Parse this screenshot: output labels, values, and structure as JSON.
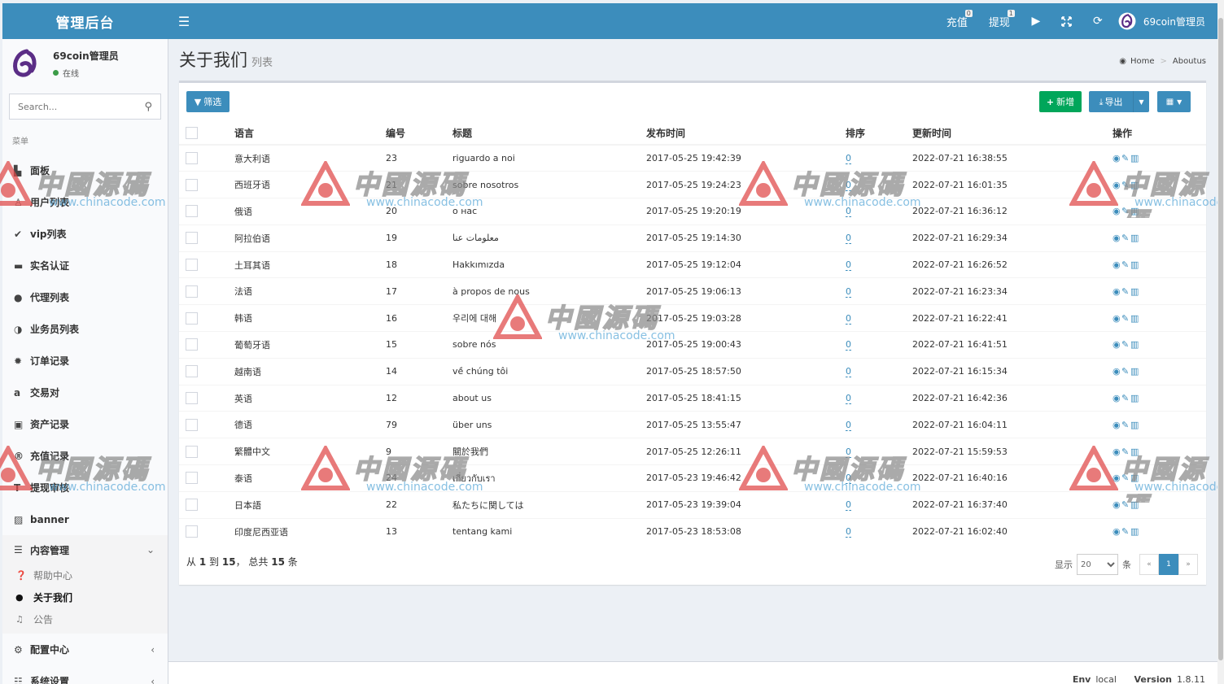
{
  "app": {
    "brand": "管理后台",
    "menu_toggle_icon": "hamburger-icon"
  },
  "topbar": {
    "recharge_label": "充值",
    "recharge_badge": "0",
    "withdraw_label": "提现",
    "withdraw_badge": "1",
    "user_name": "69coin管理员"
  },
  "sidebar": {
    "user_name": "69coin管理员",
    "user_status": "在线",
    "search_placeholder": "Search...",
    "menu_header": "菜单",
    "items": [
      {
        "label": "面板",
        "icon": "bar-chart-icon"
      },
      {
        "label": "用户列表",
        "icon": "users-icon"
      },
      {
        "label": "vip列表",
        "icon": "check-circle-icon"
      },
      {
        "label": "实名认证",
        "icon": "id-card-icon"
      },
      {
        "label": "代理列表",
        "icon": "circle-icon"
      },
      {
        "label": "业务员列表",
        "icon": "half-circle-icon"
      },
      {
        "label": "订单记录",
        "icon": "gear-icon"
      },
      {
        "label": "交易对",
        "icon": "amazon-icon"
      },
      {
        "label": "资产记录",
        "icon": "money-icon"
      },
      {
        "label": "充值记录",
        "icon": "registered-icon"
      },
      {
        "label": "提现审核",
        "icon": "text-height-icon"
      },
      {
        "label": "banner",
        "icon": "image-icon"
      }
    ],
    "content_menu": {
      "label": "内容管理",
      "children": [
        {
          "label": "帮助中心",
          "icon": "question-circle-icon"
        },
        {
          "label": "关于我们",
          "icon": "info-circle-icon"
        },
        {
          "label": "公告",
          "icon": "bell-icon"
        }
      ]
    },
    "config_menu": "配置中心",
    "settings_menu": "系统设置"
  },
  "page": {
    "title": "关于我们",
    "subtitle": "列表",
    "breadcrumb_home": "Home",
    "breadcrumb_current": "Aboutus"
  },
  "toolbar": {
    "filter_label": "筛选",
    "new_label": "新增",
    "export_label": "导出"
  },
  "table": {
    "headers": [
      "语言",
      "编号",
      "标题",
      "发布时间",
      "排序",
      "更新时间",
      "操作"
    ],
    "rows": [
      {
        "lang": "意大利语",
        "id": "23",
        "title": "riguardo a noi",
        "published": "2017-05-25 19:42:39",
        "sort": "0",
        "updated": "2022-07-21 16:38:55"
      },
      {
        "lang": "西班牙语",
        "id": "21",
        "title": "sobre nosotros",
        "published": "2017-05-25 19:24:23",
        "sort": "0",
        "updated": "2022-07-21 16:01:35"
      },
      {
        "lang": "俄语",
        "id": "20",
        "title": "о нас",
        "published": "2017-05-25 19:20:19",
        "sort": "0",
        "updated": "2022-07-21 16:36:12"
      },
      {
        "lang": "阿拉伯语",
        "id": "19",
        "title": "معلومات عنا",
        "published": "2017-05-25 19:14:30",
        "sort": "0",
        "updated": "2022-07-21 16:29:34"
      },
      {
        "lang": "土耳其语",
        "id": "18",
        "title": "Hakkımızda",
        "published": "2017-05-25 19:12:04",
        "sort": "0",
        "updated": "2022-07-21 16:26:52"
      },
      {
        "lang": "法语",
        "id": "17",
        "title": "à propos de nous",
        "published": "2017-05-25 19:06:13",
        "sort": "0",
        "updated": "2022-07-21 16:23:34"
      },
      {
        "lang": "韩语",
        "id": "16",
        "title": "우리에 대해",
        "published": "2017-05-25 19:03:28",
        "sort": "0",
        "updated": "2022-07-21 16:22:41"
      },
      {
        "lang": "葡萄牙语",
        "id": "15",
        "title": "sobre nós",
        "published": "2017-05-25 19:00:43",
        "sort": "0",
        "updated": "2022-07-21 16:41:51"
      },
      {
        "lang": "越南语",
        "id": "14",
        "title": "về chúng tôi",
        "published": "2017-05-25 18:57:50",
        "sort": "0",
        "updated": "2022-07-21 16:15:34"
      },
      {
        "lang": "英语",
        "id": "12",
        "title": "about us",
        "published": "2017-05-25 18:41:15",
        "sort": "0",
        "updated": "2022-07-21 16:42:36"
      },
      {
        "lang": "德语",
        "id": "79",
        "title": "über uns",
        "published": "2017-05-25 13:55:47",
        "sort": "0",
        "updated": "2022-07-21 16:04:11"
      },
      {
        "lang": "繁體中文",
        "id": "9",
        "title": "關於我們",
        "published": "2017-05-25 12:26:11",
        "sort": "0",
        "updated": "2022-07-21 15:59:53"
      },
      {
        "lang": "泰语",
        "id": "24",
        "title": "เกี่ยวกับเรา",
        "published": "2017-05-23 19:46:42",
        "sort": "0",
        "updated": "2022-07-21 16:40:16"
      },
      {
        "lang": "日本語",
        "id": "22",
        "title": "私たちに関しては",
        "published": "2017-05-23 19:39:04",
        "sort": "0",
        "updated": "2022-07-21 16:37:40"
      },
      {
        "lang": "印度尼西亚语",
        "id": "13",
        "title": "tentang kami",
        "published": "2017-05-23 18:53:08",
        "sort": "0",
        "updated": "2022-07-21 16:02:40"
      }
    ],
    "row_actions": [
      "eye-icon",
      "edit-icon",
      "trash-icon"
    ]
  },
  "pagination": {
    "summary_prefix": "从",
    "from": "1",
    "to_word": "到",
    "to": "15",
    "total_word": "，  总共",
    "total": "15",
    "unit": "条",
    "show_label": "显示",
    "per_page": "20",
    "per_page_unit": "条",
    "prev": "«",
    "current_page": "1",
    "next": "»"
  },
  "footer": {
    "env_label": "Env",
    "env_value": "local",
    "version_label": "Version",
    "version_value": "1.8.11"
  },
  "watermark": {
    "text": "中國源碼",
    "url": "www.chinacode.com"
  },
  "colors": {
    "header_bg": "#3c8dbc",
    "new_button": "#00a65a",
    "accent": "#3c8dbc"
  }
}
